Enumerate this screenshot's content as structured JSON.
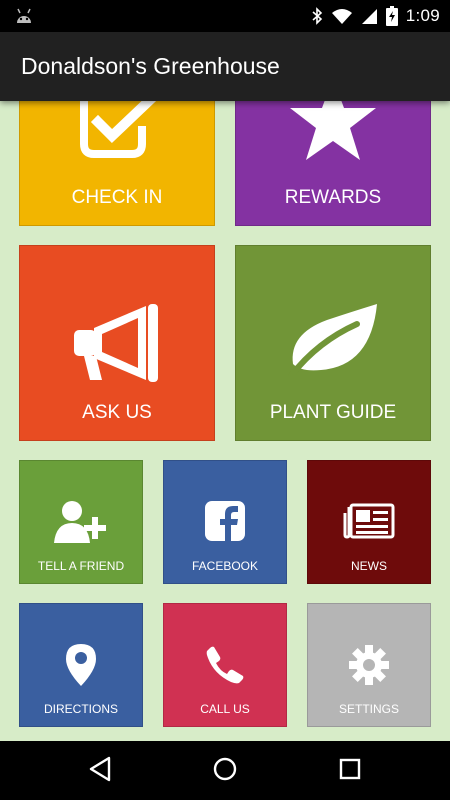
{
  "status_bar": {
    "time": "1:09",
    "icons": [
      "android-icon",
      "bluetooth-icon",
      "wifi-icon",
      "signal-icon",
      "battery-icon"
    ]
  },
  "app_bar": {
    "title": "Donaldson's Greenhouse"
  },
  "tiles": {
    "check_in": {
      "label": "CHECK IN",
      "color": "#f2b500",
      "icon": "checkbox-icon"
    },
    "rewards": {
      "label": "REWARDS",
      "color": "#8432a2",
      "icon": "star-icon"
    },
    "ask_us": {
      "label": "ASK US",
      "color": "#e84c22",
      "icon": "megaphone-icon"
    },
    "plant_guide": {
      "label": "PLANT GUIDE",
      "color": "#719537",
      "icon": "leaf-icon"
    },
    "tell_a_friend": {
      "label": "TELL A FRIEND",
      "color": "#6a9f3a",
      "icon": "add-user-icon"
    },
    "facebook": {
      "label": "FACEBOOK",
      "color": "#3a5fa0",
      "icon": "facebook-icon"
    },
    "news": {
      "label": "NEWS",
      "color": "#6e0b0b",
      "icon": "newspaper-icon"
    },
    "directions": {
      "label": "DIRECTIONS",
      "color": "#3a5fa0",
      "icon": "map-pin-icon"
    },
    "call_us": {
      "label": "CALL US",
      "color": "#d03152",
      "icon": "phone-icon"
    },
    "settings": {
      "label": "SETTINGS",
      "color": "#b5b5b5",
      "icon": "gear-icon"
    }
  },
  "nav_bar": {
    "icons": [
      "back-icon",
      "home-icon",
      "recents-icon"
    ]
  }
}
